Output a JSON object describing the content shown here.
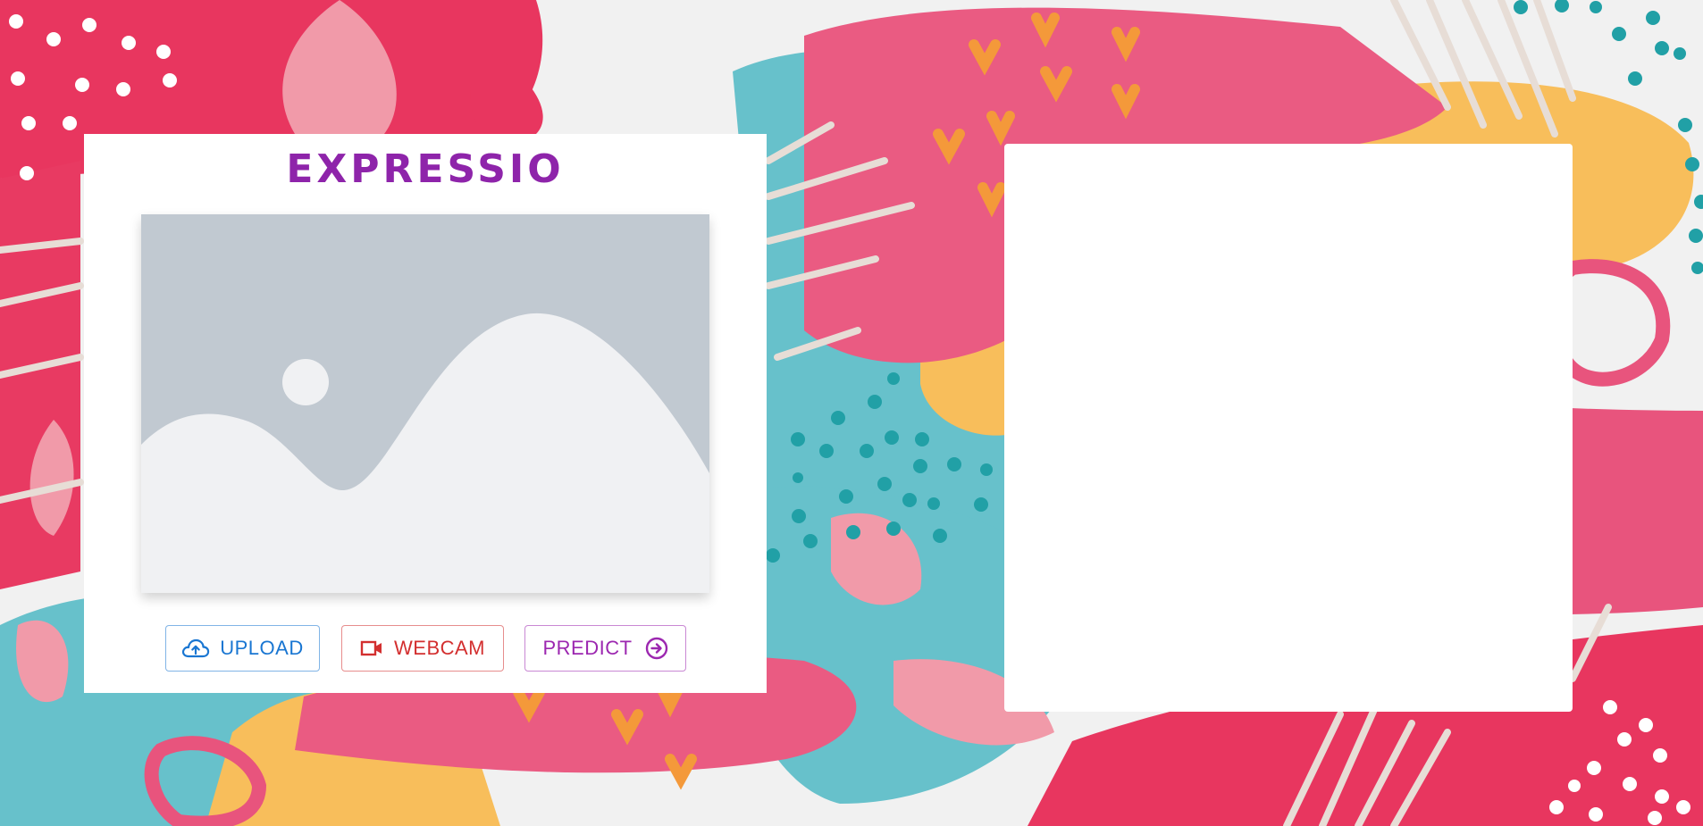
{
  "app": {
    "title": "EXPRESSIO"
  },
  "preview": {
    "icon": "image-placeholder-icon"
  },
  "actions": {
    "upload_label": "UPLOAD",
    "upload_icon": "cloud-upload-icon",
    "webcam_label": "WEBCAM",
    "webcam_icon": "video-camera-icon",
    "predict_label": "PREDICT",
    "predict_icon": "arrow-right-circle-icon"
  },
  "colors": {
    "title": "#8e24aa",
    "upload": "#1976d2",
    "webcam": "#d32f2f",
    "predict": "#9c27b0",
    "placeholder_bg": "#c1c9d1",
    "placeholder_fg": "#f0f1f3"
  }
}
